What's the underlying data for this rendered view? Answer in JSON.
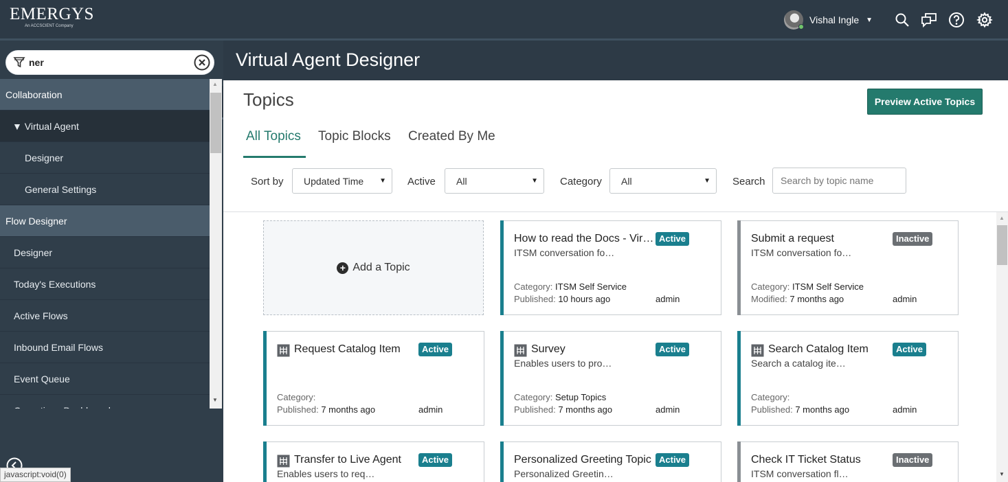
{
  "header": {
    "logo_main": "EMERGYS",
    "logo_sub": "An ACCSCIENT Company",
    "user_name": "Vishal Ingle",
    "user_caret": "▼"
  },
  "sidebar": {
    "filter_value": "ner",
    "nav_items": [
      {
        "label": "Collaboration",
        "kind": "section"
      },
      {
        "label": "▼ Virtual Agent",
        "kind": "module"
      },
      {
        "label": "Designer",
        "kind": "sub"
      },
      {
        "label": "General Settings",
        "kind": "sub"
      },
      {
        "label": "Flow Designer",
        "kind": "section"
      },
      {
        "label": "Designer",
        "kind": "flat"
      },
      {
        "label": "Today's Executions",
        "kind": "flat"
      },
      {
        "label": "Active Flows",
        "kind": "flat"
      },
      {
        "label": "Inbound Email Flows",
        "kind": "flat"
      },
      {
        "label": "Event Queue",
        "kind": "flat"
      },
      {
        "label": "Operations Dashboard",
        "kind": "flat"
      }
    ],
    "status_text": "javascript:void(0)"
  },
  "main": {
    "page_title": "Virtual Agent Designer",
    "topics_title": "Topics",
    "preview_button": "Preview Active Topics",
    "tabs": [
      "All Topics",
      "Topic Blocks",
      "Created By Me"
    ],
    "active_tab": "All Topics",
    "filters": {
      "sort_label": "Sort by",
      "sort_value": "Updated Time",
      "active_label": "Active",
      "active_value": "All",
      "category_label": "Category",
      "category_value": "All",
      "search_label": "Search",
      "search_placeholder": "Search by topic name"
    },
    "add_topic_label": "Add a Topic",
    "labels": {
      "category": "Category:",
      "published": "Published:",
      "modified": "Modified:"
    },
    "cards": [
      {
        "name": "How to read the Docs - Vir…",
        "status": "Active",
        "desc": "ITSM conversation fo…",
        "category": "ITSM Self Service",
        "date_label": "Published:",
        "date": "10 hours ago",
        "owner": "admin",
        "has_icon": false
      },
      {
        "name": "Submit a request",
        "status": "Inactive",
        "desc": "ITSM conversation fo…",
        "category": "ITSM Self Service",
        "date_label": "Modified:",
        "date": "7 months ago",
        "owner": "admin",
        "has_icon": false
      },
      {
        "name": "Request Catalog Item",
        "status": "Active",
        "desc": "",
        "category": "",
        "date_label": "Published:",
        "date": "7 months ago",
        "owner": "admin",
        "has_icon": true
      },
      {
        "name": "Survey",
        "status": "Active",
        "desc": "Enables users to pro…",
        "category": "Setup Topics",
        "date_label": "Published:",
        "date": "7 months ago",
        "owner": "admin",
        "has_icon": true
      },
      {
        "name": "Search Catalog Item",
        "status": "Active",
        "desc": "Search a catalog ite…",
        "category": "",
        "date_label": "Published:",
        "date": "7 months ago",
        "owner": "admin",
        "has_icon": true
      },
      {
        "name": "Transfer to Live Agent",
        "status": "Active",
        "desc": "Enables users to req…",
        "has_icon": true
      },
      {
        "name": "Personalized Greeting Topic",
        "status": "Active",
        "desc": "Personalized Greetin…",
        "has_icon": false
      },
      {
        "name": "Check IT Ticket Status",
        "status": "Inactive",
        "desc": "ITSM conversation fl…",
        "has_icon": false
      }
    ]
  },
  "colors": {
    "header_bg": "#2d3a46",
    "sidebar_bg": "#303e4a",
    "accent": "#247a6d",
    "active_badge": "#1a7f8e",
    "inactive_badge": "#6b6f73",
    "active_bar": "#1a7f8e",
    "inactive_bar": "#8a8f94"
  },
  "icons": {
    "search": "search-icon",
    "chat": "chat-icon",
    "help": "help-icon",
    "settings": "gear-icon",
    "filter": "filter-icon",
    "clear": "clear-icon",
    "archive": "archive-icon",
    "favorites": "star-icon",
    "history": "clock-icon",
    "topic": "topic-grid-icon"
  }
}
